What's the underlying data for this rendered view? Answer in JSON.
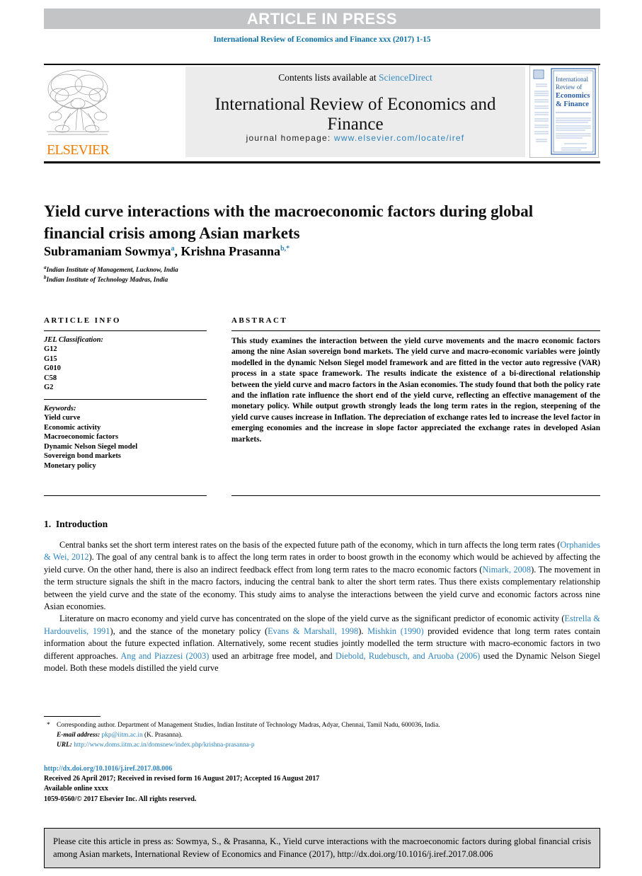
{
  "banner": {
    "text": "ARTICLE IN PRESS",
    "bg_color": "#c3c4c6",
    "text_color": "#ffffff"
  },
  "running_head": "International Review of Economics and Finance xxx (2017) 1-15",
  "masthead": {
    "publisher_name": "ELSEVIER",
    "publisher_color": "#f07d00",
    "contents_prefix": "Contents lists available at ",
    "contents_link": "ScienceDirect",
    "journal_title": "International Review of Economics and Finance",
    "homepage_label": "journal homepage: ",
    "homepage_url": "www.elsevier.com/locate/iref",
    "link_color": "#2d83bd",
    "cover": {
      "line1": "International",
      "line2": "Review of",
      "line3": "Economics",
      "line4": "& Finance"
    }
  },
  "article": {
    "title": "Yield curve interactions with the macroeconomic factors during global financial crisis among Asian markets",
    "authors_plain": "Subramaniam Sowmya",
    "author1": "Subramaniam Sowmya",
    "author1_sup": "a",
    "author2": "Krishna Prasanna",
    "author2_sup": "b,",
    "author2_star": "*",
    "affiliations": [
      {
        "marker": "a",
        "text": "Indian Institute of Management, Lucknow, India"
      },
      {
        "marker": "b",
        "text": "Indian Institute of Technology Madras, India"
      }
    ]
  },
  "article_info": {
    "heading": "ARTICLE INFO",
    "jel_label": "JEL Classification:",
    "jel_codes": [
      "G12",
      "G15",
      "G010",
      "C58",
      "G2"
    ],
    "keywords_label": "Keywords:",
    "keywords": [
      "Yield curve",
      "Economic activity",
      "Macroeconomic factors",
      "Dynamic Nelson Siegel model",
      "Sovereign bond markets",
      "Monetary policy"
    ]
  },
  "abstract": {
    "heading": "ABSTRACT",
    "body": "This study examines the interaction between the yield curve movements and the macro economic factors among the nine Asian sovereign bond markets. The yield curve and macro-economic variables were jointly modelled in the dynamic Nelson Siegel model framework and are fitted in the vector auto regressive (VAR) process in a state space framework. The results indicate the existence of a bi-directional relationship between the yield curve and macro factors in the Asian economies. The study found that both the policy rate and the inflation rate influence the short end of the yield curve, reflecting an effective management of the monetary policy. While output growth strongly leads the long term rates in the region, steepening of the yield curve causes increase in Inflation. The depreciation of exchange rates led to increase the level factor in emerging economies and the increase in slope factor appreciated the exchange rates in developed Asian markets."
  },
  "body": {
    "section_number": "1.",
    "section_title": "Introduction",
    "paragraph1_parts": [
      {
        "text": "Central banks set the short term interest rates on the basis of the expected future path of the economy, which in turn affects the long term rates (",
        "link": false
      },
      {
        "text": "Orphanides & Wei, 2012",
        "link": true
      },
      {
        "text": "). The goal of any central bank is to affect the long term rates in order to boost growth in the economy which would be achieved by affecting the yield curve. On the other hand, there is also an indirect feedback effect from long term rates to the macro economic factors (",
        "link": false
      },
      {
        "text": "Nimark, 2008",
        "link": true
      },
      {
        "text": "). The movement in the term structure signals the shift in the macro factors, inducing the central bank to alter the short term rates. Thus there exists complementary relationship between the yield curve and the state of the economy. This study aims to analyse the interactions between the yield curve and economic factors across nine Asian economies.",
        "link": false
      }
    ],
    "paragraph2_parts": [
      {
        "text": "Literature on macro economy and yield curve has concentrated on the slope of the yield curve as the significant predictor of economic activity (",
        "link": false
      },
      {
        "text": "Estrella & Hardouvelis, 1991",
        "link": true
      },
      {
        "text": "), and the stance of the monetary policy (",
        "link": false
      },
      {
        "text": "Evans & Marshall, 1998",
        "link": true
      },
      {
        "text": "). ",
        "link": false
      },
      {
        "text": "Mishkin (1990)",
        "link": true
      },
      {
        "text": " provided evidence that long term rates contain information about the future expected inflation. Alternatively, some recent studies jointly modelled the term structure with macro-economic factors in two different approaches. ",
        "link": false
      },
      {
        "text": "Ang and Piazzesi (2003)",
        "link": true
      },
      {
        "text": " used an arbitrage free model, and ",
        "link": false
      },
      {
        "text": "Diebold, Rudebusch, and Aruoba (2006)",
        "link": true
      },
      {
        "text": " used the Dynamic Nelson Siegel model. Both these models distilled the yield curve",
        "link": false
      }
    ]
  },
  "footnote": {
    "star": "*",
    "corresponding": "Corresponding author. Department of Management Studies, Indian Institute of Technology Madras, Adyar, Chennai, Tamil Nadu, 600036, India.",
    "email_label": "E-mail address:",
    "email": "pkp@iitm.ac.in",
    "email_suffix": "(K. Prasanna).",
    "url_label": "URL:",
    "url": "http://www.doms.iitm.ac.in/domsnew/index.php/krishna-prasanna-p"
  },
  "publication": {
    "doi_url": "http://dx.doi.org/10.1016/j.iref.2017.08.006",
    "dates": "Received 26 April 2017; Received in revised form 16 August 2017; Accepted 16 August 2017",
    "available_online": "Available online xxxx",
    "copyright": "1059-0560/© 2017 Elsevier Inc. All rights reserved."
  },
  "citation_box": {
    "text": "Please cite this article in press as: Sowmya, S., & Prasanna, K., Yield curve interactions with the macroeconomic factors during global financial crisis among Asian markets, International Review of Economics and Finance (2017), http://dx.doi.org/10.1016/j.iref.2017.08.006"
  }
}
